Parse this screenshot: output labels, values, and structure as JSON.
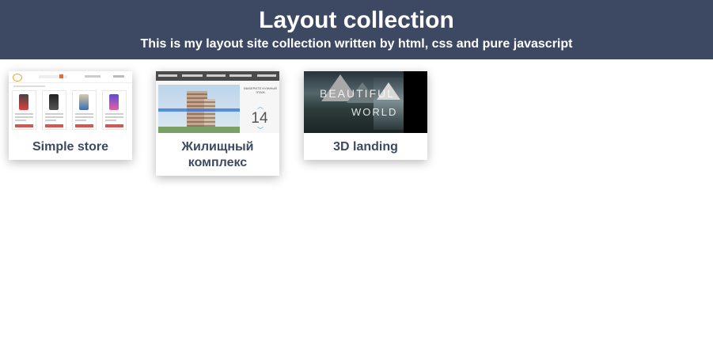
{
  "header": {
    "title": "Layout collection",
    "subtitle": "This is my layout site collection written by html, css and pure javascript"
  },
  "cards": [
    {
      "title": "Simple store",
      "thumb": "simple-store-preview"
    },
    {
      "title": "Жилищный комплекс",
      "thumb": "housing-complex-preview"
    },
    {
      "title": "3D landing",
      "thumb": "3d-landing-preview"
    }
  ],
  "previews": {
    "housing": {
      "choose_floor": "ВЫБЕРИТЕ НУЖНЫЙ ЭТАЖ",
      "floor_number": "14"
    },
    "landing": {
      "word1": "BEAUTIFUL",
      "word2": "WORLD"
    }
  },
  "colors": {
    "header_bg": "#3d4963",
    "card_title": "#3d4963",
    "page_bg": "#ffffff"
  }
}
